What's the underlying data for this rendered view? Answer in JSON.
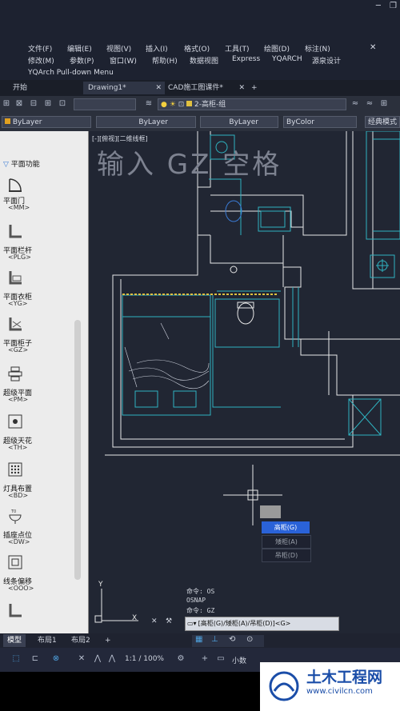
{
  "menu": {
    "row1": [
      "文件(F)",
      "编辑(E)",
      "视图(V)",
      "插入(I)",
      "格式(O)",
      "工具(T)",
      "绘图(D)",
      "标注(N)"
    ],
    "row2": [
      "修改(M)",
      "参数(P)",
      "窗口(W)",
      "帮助(H)",
      "数据视图",
      "Express",
      "YQARCH",
      "源泉设计"
    ],
    "row3": "YQArch Pull-down Menu"
  },
  "tabs": [
    {
      "label": "开始"
    },
    {
      "label": "Drawing1*"
    },
    {
      "label": "CAD施工图课件*"
    }
  ],
  "toolbar": {
    "layer": "2-高柜-组",
    "color1": "ByLayer",
    "linetype": "ByLayer",
    "lineweight": "ByLayer",
    "plotstyle": "ByColor",
    "workspace": "经典模式"
  },
  "palette": {
    "title": "平面功能",
    "items": [
      {
        "label": "平面门",
        "code": "<MM>"
      },
      {
        "label": "平面栏杆",
        "code": "<PLG>"
      },
      {
        "label": "平面衣柜",
        "code": "<YG>"
      },
      {
        "label": "平面柜子",
        "code": "<GZ>"
      },
      {
        "label": "超级平面",
        "code": "<PM>"
      },
      {
        "label": "超级天花",
        "code": "<TH>"
      },
      {
        "label": "灯具布置",
        "code": "<BD>"
      },
      {
        "label": "插座点位",
        "code": "<DW>"
      },
      {
        "label": "线条偏移",
        "code": "<OOO>"
      }
    ]
  },
  "canvas": {
    "viewlabel": "[-][俯视][二维线框]",
    "overlay": "输入 GZ 空格",
    "options": [
      {
        "label": "高柜(G)",
        "active": true
      },
      {
        "label": "矮柜(A)",
        "active": false
      },
      {
        "label": "吊柜(D)",
        "active": false
      }
    ],
    "axis_y": "Y",
    "axis_x": "X"
  },
  "command": {
    "history": [
      "命令: OS",
      "OSNAP",
      "命令: GZ"
    ],
    "prompt": "[高柜(G)/矮柜(A)/吊柜(D)]<G>"
  },
  "layouts": [
    "模型",
    "布局1",
    "布局2"
  ],
  "status": {
    "scale": "1:1 / 100%",
    "decimal": "小数"
  },
  "watermark": {
    "cn": "土木工程网",
    "url": "www.civilcn.com"
  },
  "colors": {
    "cad_bg": "#212633",
    "wall": "#e8e8e8",
    "cyan": "#2fb3c0",
    "yellow": "#e0c040",
    "blue": "#2a62d8"
  }
}
